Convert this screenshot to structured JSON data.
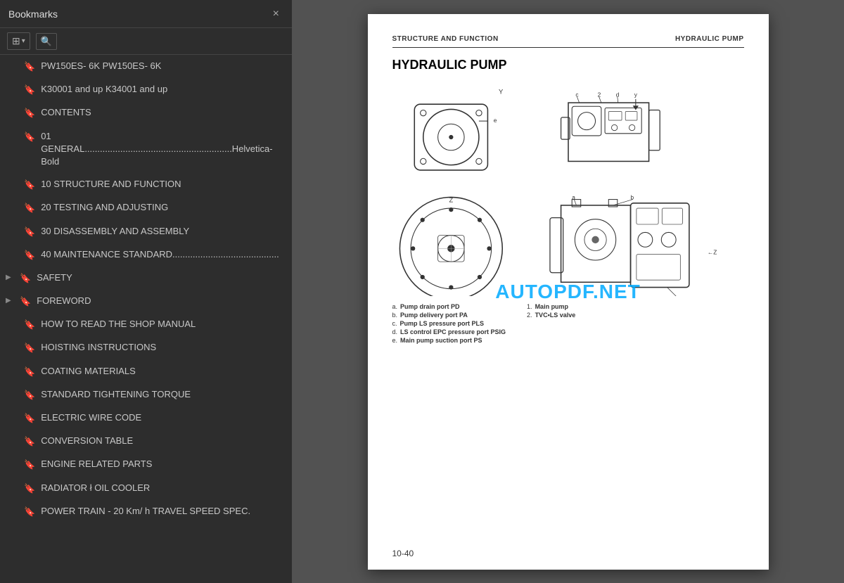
{
  "bookmarks": {
    "title": "Bookmarks",
    "close_label": "×",
    "toolbar": {
      "expand_icon": "⊞",
      "search_icon": "🔍"
    },
    "items": [
      {
        "id": 1,
        "label": "PW150ES- 6K PW150ES- 6K",
        "indent": 0,
        "expandable": false
      },
      {
        "id": 2,
        "label": "K30001 and up K34001 and up",
        "indent": 0,
        "expandable": false
      },
      {
        "id": 3,
        "label": "CONTENTS",
        "indent": 0,
        "expandable": false
      },
      {
        "id": 4,
        "label": "01 GENERAL..........................................................Helvetica-Bold",
        "indent": 0,
        "expandable": false
      },
      {
        "id": 5,
        "label": "10 STRUCTURE AND FUNCTION",
        "indent": 0,
        "expandable": false
      },
      {
        "id": 6,
        "label": "20 TESTING AND ADJUSTING",
        "indent": 0,
        "expandable": false
      },
      {
        "id": 7,
        "label": "30 DISASSEMBLY AND ASSEMBLY",
        "indent": 0,
        "expandable": false
      },
      {
        "id": 8,
        "label": "40 MAINTENANCE STANDARD..........................................",
        "indent": 0,
        "expandable": false
      },
      {
        "id": 9,
        "label": "SAFETY",
        "indent": 0,
        "expandable": true
      },
      {
        "id": 10,
        "label": "FOREWORD",
        "indent": 0,
        "expandable": true
      },
      {
        "id": 11,
        "label": "HOW TO READ THE SHOP MANUAL",
        "indent": 0,
        "expandable": false
      },
      {
        "id": 12,
        "label": "HOISTING INSTRUCTIONS",
        "indent": 0,
        "expandable": false
      },
      {
        "id": 13,
        "label": "COATING MATERIALS",
        "indent": 0,
        "expandable": false
      },
      {
        "id": 14,
        "label": "STANDARD TIGHTENING TORQUE",
        "indent": 0,
        "expandable": false
      },
      {
        "id": 15,
        "label": "ELECTRIC WIRE CODE",
        "indent": 0,
        "expandable": false
      },
      {
        "id": 16,
        "label": "CONVERSION TABLE",
        "indent": 0,
        "expandable": false
      },
      {
        "id": 17,
        "label": "ENGINE RELATED PARTS",
        "indent": 0,
        "expandable": false
      },
      {
        "id": 18,
        "label": "RADIATOR ł OIL COOLER",
        "indent": 0,
        "expandable": false
      },
      {
        "id": 19,
        "label": "POWER TRAIN - 20 Km/ h TRAVEL SPEED SPEC.",
        "indent": 0,
        "expandable": false
      }
    ]
  },
  "pdf": {
    "header_left": "STRUCTURE AND FUNCTION",
    "header_right": "HYDRAULIC PUMP",
    "main_title": "HYDRAULIC PUMP",
    "watermark": "AUTOPDF.NET",
    "page_number": "10-40",
    "labels_col1": [
      {
        "key": "a.",
        "val": "Pump drain port PD"
      },
      {
        "key": "b.",
        "val": "Pump delivery port PA"
      },
      {
        "key": "c.",
        "val": "Pump LS pressure port PLS"
      },
      {
        "key": "d.",
        "val": "LS control EPC pressure port PSIG"
      },
      {
        "key": "e.",
        "val": "Main pump suction port PS"
      }
    ],
    "labels_col2": [
      {
        "key": "1.",
        "val": "Main pump"
      },
      {
        "key": "2.",
        "val": "TVC•LS valve"
      }
    ]
  }
}
